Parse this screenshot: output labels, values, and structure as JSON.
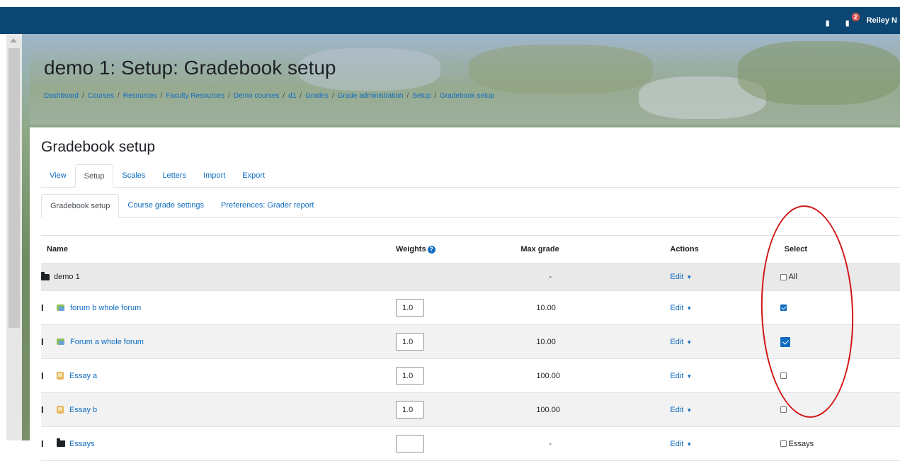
{
  "navbar": {
    "user_name": "Reiley N",
    "messages_badge": "2",
    "notification_icon": "bell-icon",
    "message_icon": "chat-icon",
    "color": "#0c4773"
  },
  "header": {
    "title": "demo 1: Setup: Gradebook setup",
    "breadcrumb": [
      "Dashboard",
      "Courses",
      "Resources",
      "Faculty Resources",
      "Demo courses",
      "d1",
      "Grades",
      "Grade administration",
      "Setup",
      "Gradebook setup"
    ],
    "separator": "/"
  },
  "main": {
    "heading": "Gradebook setup",
    "tabs": [
      "View",
      "Setup",
      "Scales",
      "Letters",
      "Import",
      "Export"
    ],
    "active_tab": "Setup",
    "subtabs": [
      "Gradebook setup",
      "Course grade settings",
      "Preferences: Grader report"
    ],
    "active_subtab": "Gradebook setup"
  },
  "table": {
    "columns": {
      "name": "Name",
      "weights": "Weights",
      "max_grade": "Max grade",
      "actions": "Actions",
      "select": "Select"
    },
    "rows": [
      {
        "name": "demo 1",
        "type": "category",
        "icon": "folder-icon",
        "weight": "",
        "max_grade": "-",
        "action": "Edit",
        "select_label": "All",
        "checked": false
      },
      {
        "name": "forum b whole forum",
        "type": "forum",
        "icon": "forum-icon",
        "weight": "1.0",
        "max_grade": "10.00",
        "action": "Edit",
        "checked": true
      },
      {
        "name": "Forum a whole forum",
        "type": "forum",
        "icon": "forum-icon",
        "weight": "1.0",
        "max_grade": "10.00",
        "action": "Edit",
        "checked": true
      },
      {
        "name": "Essay a",
        "type": "quiz",
        "icon": "quiz-icon",
        "weight": "1.0",
        "max_grade": "100.00",
        "action": "Edit",
        "checked": false
      },
      {
        "name": "Essay b",
        "type": "quiz",
        "icon": "quiz-icon",
        "weight": "1.0",
        "max_grade": "100.00",
        "action": "Edit",
        "checked": false
      },
      {
        "name": "Essays",
        "type": "category",
        "icon": "folder-icon",
        "weight": "",
        "max_grade": "-",
        "action": "Edit",
        "select_label": "Essays",
        "checked": false
      }
    ]
  },
  "colors": {
    "link": "#0f6cbf",
    "annotation": "#d21515"
  }
}
